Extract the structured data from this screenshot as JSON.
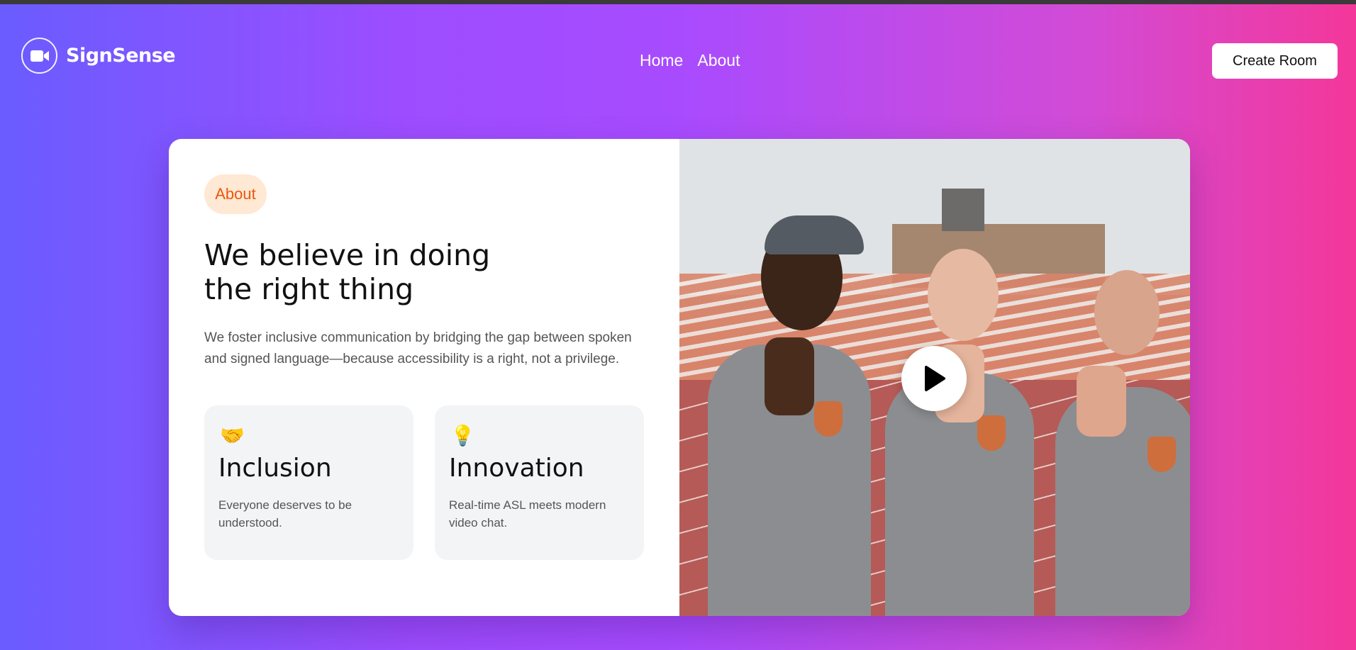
{
  "header": {
    "brand": "SignSense",
    "logo_icon": "video-camera-icon",
    "nav": [
      {
        "label": "Home"
      },
      {
        "label": "About"
      }
    ],
    "cta_label": "Create Room"
  },
  "about": {
    "badge": "About",
    "headline_line1": "We believe in doing",
    "headline_line2": "the right thing",
    "description": "We foster inclusive communication by bridging the gap between spoken and signed language—because accessibility is a right, not a privilege.",
    "features": [
      {
        "emoji": "🤝",
        "icon": "handshake-icon",
        "title": "Inclusion",
        "text": "Everyone deserves to be understood."
      },
      {
        "emoji": "💡",
        "icon": "lightbulb-icon",
        "title": "Innovation",
        "text": "Real-time ASL meets modern video chat."
      }
    ],
    "media": {
      "play_icon": "play-icon"
    }
  },
  "colors": {
    "gradient_start": "#6a5cff",
    "gradient_mid": "#a84bff",
    "gradient_end": "#f4379a",
    "badge_bg": "#ffe8d4",
    "badge_text": "#ea580c"
  }
}
